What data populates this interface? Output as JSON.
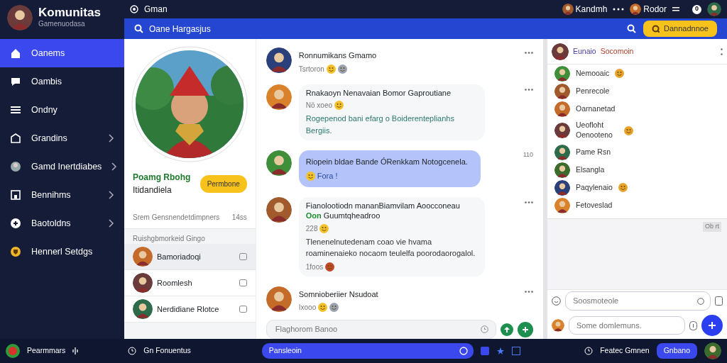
{
  "app": {
    "title": "Komunitas",
    "subtitle": "Gamenuodasa"
  },
  "topbar": {
    "label": "Gman",
    "users": [
      {
        "name": "Kandmh"
      },
      {
        "name": "Rodor"
      }
    ],
    "badge": "0"
  },
  "searchbar": {
    "placeholder": "Oane Hargasjus",
    "button": "Dannadnnoe"
  },
  "sidebar": {
    "items": [
      {
        "label": "Oanems",
        "selected": true,
        "expandable": false
      },
      {
        "label": "Oambis",
        "selected": false,
        "expandable": false
      },
      {
        "label": "Ondny",
        "selected": false,
        "expandable": false
      },
      {
        "label": "Grandins",
        "selected": false,
        "expandable": true
      },
      {
        "label": "Gamd Inertdiabes",
        "selected": false,
        "expandable": true
      },
      {
        "label": "Bennihms",
        "selected": false,
        "expandable": true
      },
      {
        "label": "Baotoldns",
        "selected": false,
        "expandable": true
      },
      {
        "label": "Hennerl Setdgs",
        "selected": false,
        "expandable": false
      }
    ]
  },
  "profile": {
    "name": "Poamg Rbohg",
    "subtitle": "Itidandiela",
    "button": "Permbone",
    "stat_label": "Srem Gensnendetdimpners",
    "stat_value": "14ss",
    "list_title": "Ruishgbmorkeid Gingo",
    "members": [
      {
        "name": "Bamoriadoqi",
        "selected": true
      },
      {
        "name": "Roomlesh",
        "selected": false
      },
      {
        "name": "Nerdidiane Rlotce",
        "selected": false
      }
    ]
  },
  "chat": {
    "messages": [
      {
        "kind": "header",
        "author": "Ronnumikans Gmamo",
        "meta": "Tsrtoron"
      },
      {
        "kind": "card",
        "author": "Rnakaoyn Nenavaian Bomor Gaproutiane",
        "meta": "Nö xoeo",
        "body": "Rogepenod bani efarg o Boiderenteplianhs Bergiis."
      },
      {
        "kind": "bubble",
        "body": "Riopein bldae Bande ÓRenkkam Notogcenela.",
        "meta": "Fora !",
        "time": "110"
      },
      {
        "kind": "card",
        "author": "Fianolootiodn mananBiamvilam Aoocconeau",
        "tag": "Oon",
        "author_rest": "Guumtqheadroo",
        "meta": "228",
        "body": "Tlenenelnutedenam coao vie hvama roaminenaieko nocaom teulelfa poorodaorogalol.",
        "footer": "1foos"
      },
      {
        "kind": "header",
        "author": "Somnioberiier Nsudoat",
        "meta": "Ixooo"
      }
    ],
    "input_placeholder": "Flaghorom Banoo"
  },
  "panel": {
    "title": "Eunaio",
    "title_extra": "Socomoin",
    "members": [
      {
        "name": "Nemooaic"
      },
      {
        "name": "Penrecole"
      },
      {
        "name": "Oarnanetad"
      },
      {
        "name": "Ueofloht Oenooteno"
      },
      {
        "name": "Pame Rsn"
      },
      {
        "name": "Elsangla"
      },
      {
        "name": "Paqylenaio"
      },
      {
        "name": "Fetoveslad"
      }
    ],
    "tag": "Ob rt",
    "input1_placeholder": "Soosmoteole",
    "input2_placeholder": "Some domlemuns."
  },
  "bottombar": {
    "app": "Pearmmars",
    "link": "Gn Fonuentus",
    "search": "Pansleoin",
    "right": "Featec Gmnen",
    "button": "Gnbano"
  }
}
